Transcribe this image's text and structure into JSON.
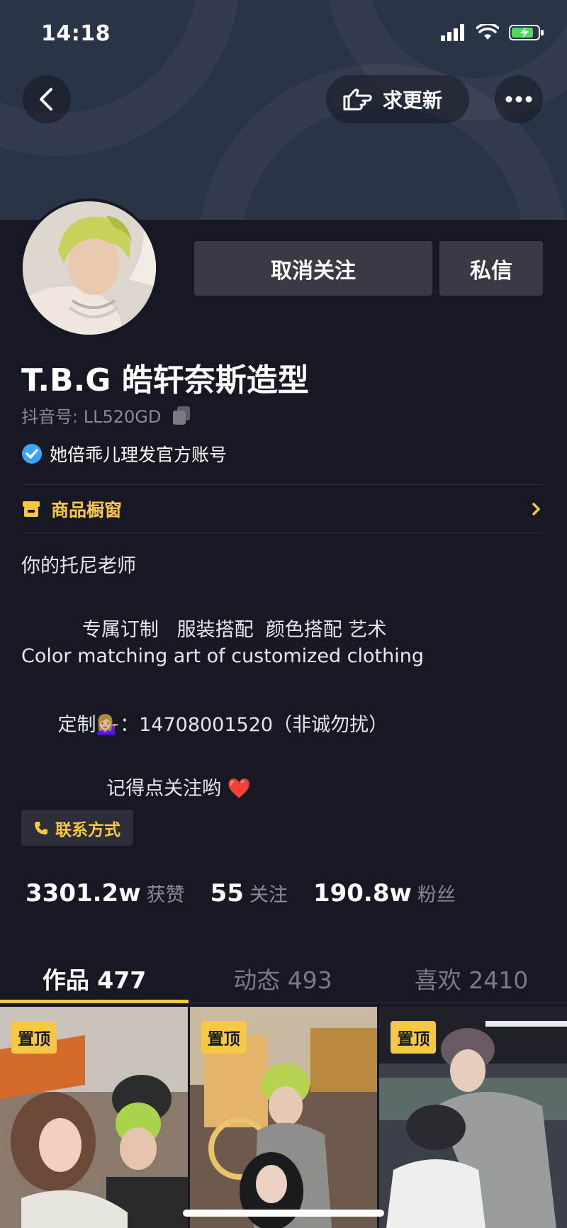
{
  "status_bar": {
    "time": "14:18"
  },
  "header": {
    "update_label": "求更新"
  },
  "profile": {
    "unfollow_label": "取消关注",
    "message_label": "私信",
    "name": "T.B.G 皓轩奈斯造型",
    "douyin_id": "抖音号: LL520GD",
    "verified_text": "她倍乖儿理发官方账号",
    "shop_label": "商品橱窗",
    "bio": [
      "你的托尼老师",
      "",
      "          专属订制   服装搭配  颜色搭配 艺术",
      "Color matching art of customized clothing",
      "",
      "      定制💁🏼‍♀️：14708001520（非诚勿扰）",
      "",
      "              记得点关注哟 ❤️"
    ],
    "contact_label": "联系方式"
  },
  "stats": [
    {
      "value": "3301.2w",
      "label": "获赞"
    },
    {
      "value": "55",
      "label": "关注"
    },
    {
      "value": "190.8w",
      "label": "粉丝"
    }
  ],
  "tabs": [
    {
      "label": "作品 477"
    },
    {
      "label": "动态 493"
    },
    {
      "label": "喜欢 2410"
    }
  ],
  "videos": [
    {
      "badge": "置顶"
    },
    {
      "badge": "置顶"
    },
    {
      "badge": "置顶"
    }
  ],
  "colors": {
    "accent": "#f9c746",
    "background": "#161823",
    "button": "#393b44",
    "verified": "#3ba3f8"
  }
}
